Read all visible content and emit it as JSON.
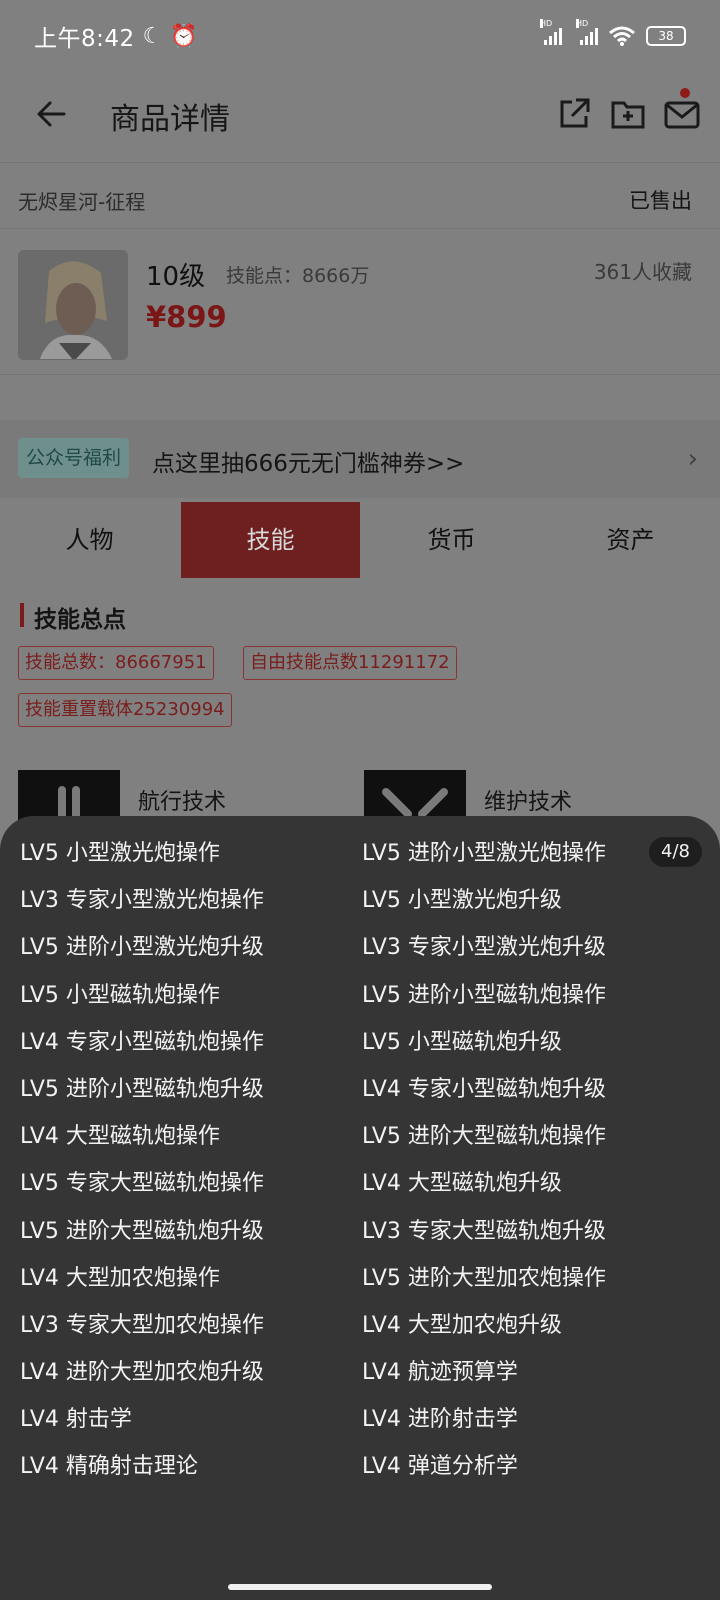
{
  "status_bar": {
    "time": "上午8:42",
    "network_1": "HD",
    "network_2": "HD",
    "battery": "38"
  },
  "app_bar": {
    "title": "商品详情"
  },
  "product": {
    "game_name": "无烬星河-征程",
    "status": "已售出",
    "level": "10级",
    "skill_points": "技能点：8666万",
    "favorites": "361人收藏",
    "price": "¥899"
  },
  "promo": {
    "tag": "公众号福利",
    "text": "点这里抽666元无门槛神券>>"
  },
  "tabs": [
    {
      "label": "人物"
    },
    {
      "label": "技能"
    },
    {
      "label": "货币"
    },
    {
      "label": "资产"
    }
  ],
  "skills_section": {
    "title": "技能总点",
    "chips": [
      "技能总数：86667951",
      "自由技能点数11291172",
      "技能重置载体25230994"
    ],
    "categories": [
      {
        "label": "航行技术",
        "icon": "gun-icon"
      },
      {
        "label": "维护技术",
        "icon": "wrench-icon"
      }
    ]
  },
  "sheet": {
    "pager": "4/8",
    "left_column": [
      "LV5 小型激光炮操作",
      "LV3 专家小型激光炮操作",
      "LV5 进阶小型激光炮升级",
      "LV5 小型磁轨炮操作",
      "LV4 专家小型磁轨炮操作",
      "LV5 进阶小型磁轨炮升级",
      "LV4 大型磁轨炮操作",
      "LV5 专家大型磁轨炮操作",
      "LV5 进阶大型磁轨炮升级",
      "LV4 大型加农炮操作",
      "LV3 专家大型加农炮操作",
      "LV4 进阶大型加农炮升级",
      "LV4 射击学",
      "LV4 精确射击理论"
    ],
    "right_column": [
      "LV5 进阶小型激光炮操作",
      "LV5 小型激光炮升级",
      "LV3 专家小型激光炮升级",
      "LV5 进阶小型磁轨炮操作",
      "LV5 小型磁轨炮升级",
      "LV4 专家小型磁轨炮升级",
      "LV5 进阶大型磁轨炮操作",
      "LV4 大型磁轨炮升级",
      "LV3 专家大型磁轨炮升级",
      "LV5 进阶大型加农炮操作",
      "LV4 大型加农炮升级",
      "LV4 航迹预算学",
      "LV4 进阶射击学",
      "LV4 弹道分析学"
    ]
  }
}
